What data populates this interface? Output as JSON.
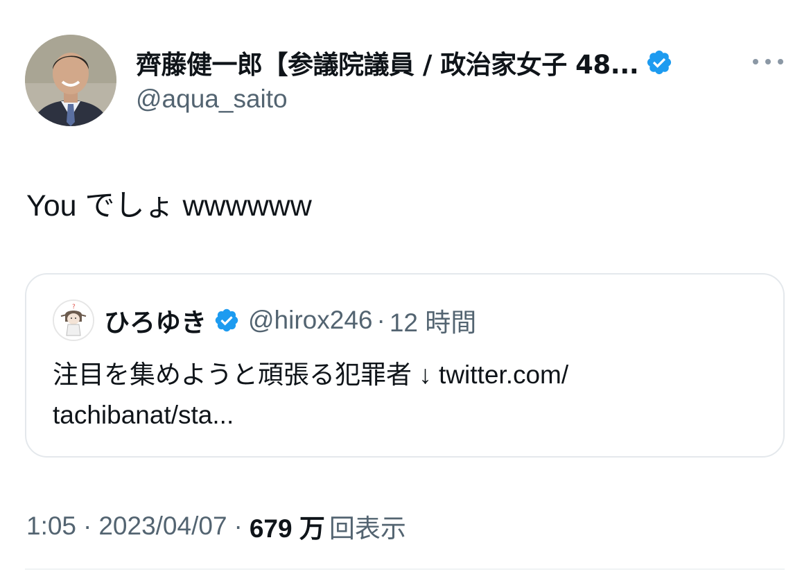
{
  "author": {
    "display_name": "齊藤健一郎【参議院議員 / 政治家女子 48...",
    "handle": "@aqua_saito",
    "verified_color": "#1d9bf0"
  },
  "tweet": {
    "text": "You でしょ wwwwww"
  },
  "quote": {
    "display_name": "ひろゆき",
    "handle": "@hirox246",
    "separator": "·",
    "time": "12 時間",
    "body_lines": [
      "注目を集めようと頑張る犯罪者 ↓ twitter.com/",
      "tachibanat/sta..."
    ]
  },
  "meta": {
    "time": "1:05",
    "separator": "·",
    "date": "2023/04/07",
    "views_count": "679 万",
    "views_label": "回表示"
  },
  "icons": {
    "verified": "verified-badge-icon",
    "more": "more-dots-icon"
  },
  "colors": {
    "text_primary": "#0f1419",
    "text_secondary": "#536471",
    "border": "#e4e8ec",
    "accent": "#1d9bf0"
  }
}
